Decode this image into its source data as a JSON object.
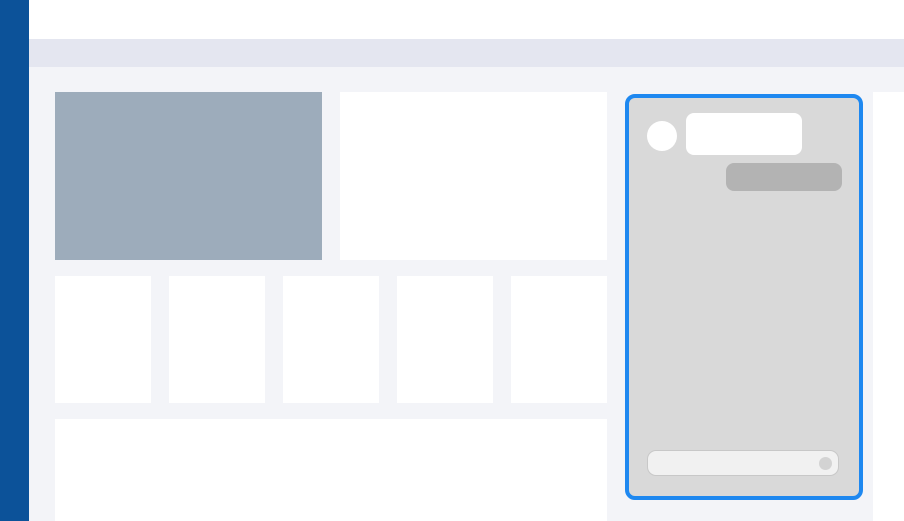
{
  "app": {
    "rail_color": "#0c5299",
    "accent_color": "#1e88f0"
  },
  "main": {
    "hero": {
      "image_color": "#9dacbb"
    },
    "tiles_count_visible": 5
  },
  "chat": {
    "panel_color": "#d9d9d9",
    "incoming_message": "",
    "outgoing_message": "",
    "input": {
      "value": "",
      "placeholder": ""
    },
    "send_icon": "send-icon"
  }
}
